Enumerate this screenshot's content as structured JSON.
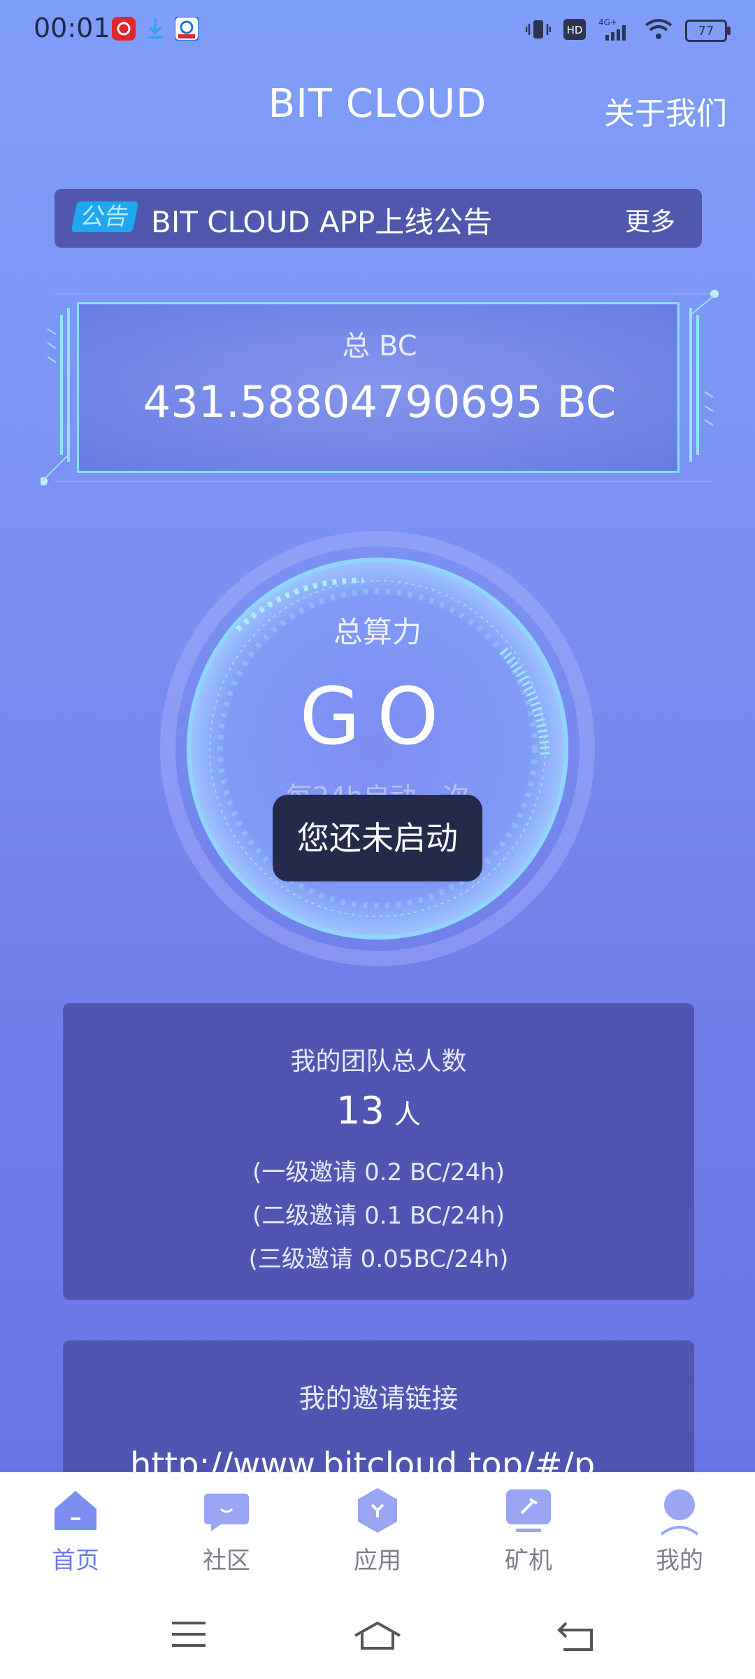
{
  "status_bar": {
    "time": "00:01",
    "battery": "77"
  },
  "header": {
    "title": "BIT CLOUD",
    "about": "关于我们"
  },
  "notice": {
    "tag": "公告",
    "text": "BIT CLOUD APP上线公告",
    "more": "更多"
  },
  "balance": {
    "label": "总 BC",
    "value": "431.58804790695 BC"
  },
  "power": {
    "label": "总算力",
    "action": "GO",
    "hint": "每24h启动一次"
  },
  "toast": {
    "text": "您还未启动"
  },
  "team": {
    "title": "我的团队总人数",
    "count": "13",
    "unit": "人",
    "tiers": [
      "(一级邀请 0.2 BC/24h)",
      "(二级邀请 0.1 BC/24h)",
      "(三级邀请 0.05BC/24h)"
    ]
  },
  "invite": {
    "title": "我的邀请链接",
    "link": "http://www.bitcloud.top/#/p..."
  },
  "bottom_nav": {
    "items": [
      {
        "label": "首页",
        "icon": "home-icon",
        "active": true
      },
      {
        "label": "社区",
        "icon": "chat-bubble-icon",
        "active": false
      },
      {
        "label": "应用",
        "icon": "hexagon-app-icon",
        "active": false
      },
      {
        "label": "矿机",
        "icon": "miner-icon",
        "active": false
      },
      {
        "label": "我的",
        "icon": "user-icon",
        "active": false
      }
    ]
  },
  "colors": {
    "accent": "#6a7ee8",
    "card": "#5155b2",
    "notice_bar": "#4f58ac",
    "toast": "#242b4a"
  }
}
